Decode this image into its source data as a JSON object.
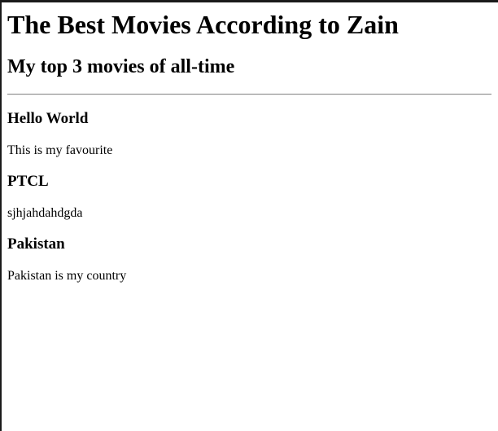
{
  "page": {
    "title": "The Best Movies According to Zain",
    "subtitle": "My top 3 movies of all-time",
    "movies": [
      {
        "title": "Hello World",
        "description": "This is my favourite"
      },
      {
        "title": "PTCL",
        "description": "sjhjahdahdgda"
      },
      {
        "title": "Pakistan",
        "description": "Pakistan is my country"
      }
    ]
  }
}
